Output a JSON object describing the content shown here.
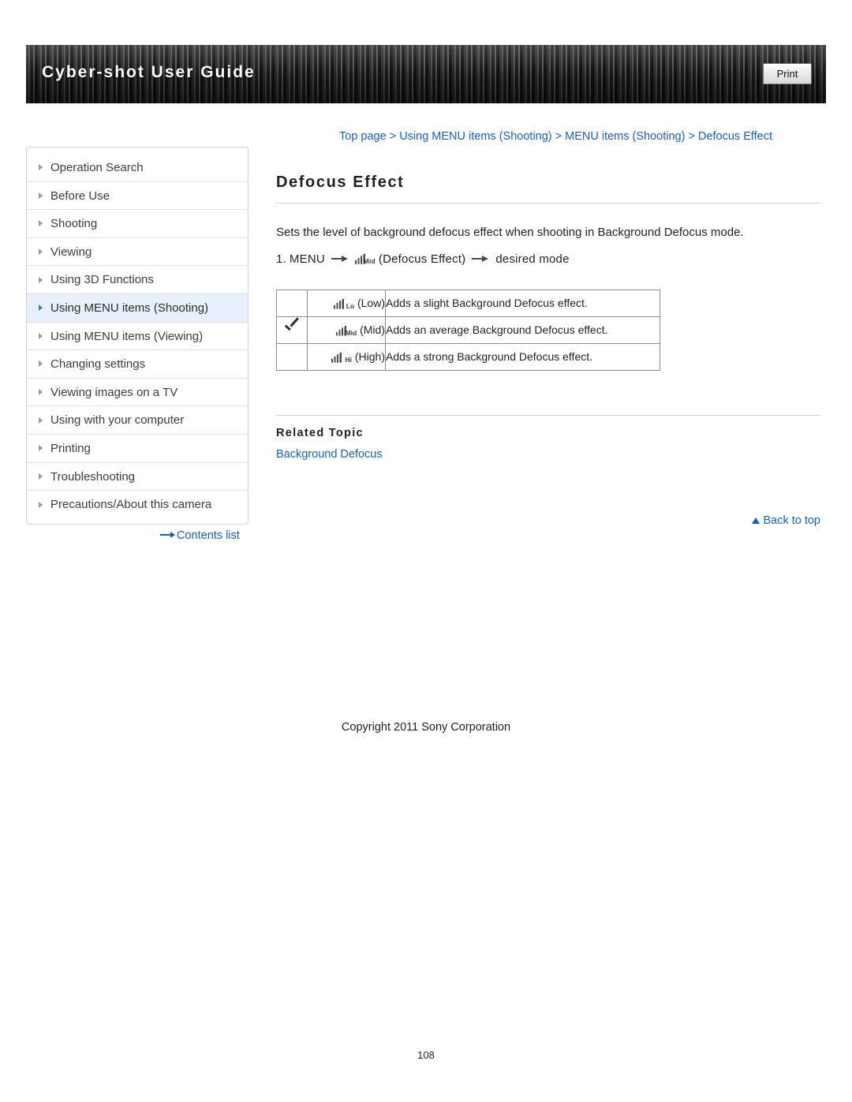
{
  "header": {
    "title": "Cyber-shot User Guide",
    "print_label": "Print"
  },
  "breadcrumb": {
    "items": [
      "Top page",
      "Using MENU items (Shooting)",
      "MENU items (Shooting)",
      "Defocus Effect"
    ],
    "separator": ">"
  },
  "sidebar": {
    "items": [
      {
        "label": "Operation Search",
        "active": false
      },
      {
        "label": "Before Use",
        "active": false
      },
      {
        "label": "Shooting",
        "active": false
      },
      {
        "label": "Viewing",
        "active": false
      },
      {
        "label": "Using 3D Functions",
        "active": false
      },
      {
        "label": "Using MENU items (Shooting)",
        "active": true
      },
      {
        "label": "Using MENU items (Viewing)",
        "active": false
      },
      {
        "label": "Changing settings",
        "active": false
      },
      {
        "label": "Viewing images on a TV",
        "active": false
      },
      {
        "label": "Using with your computer",
        "active": false
      },
      {
        "label": "Printing",
        "active": false
      },
      {
        "label": "Troubleshooting",
        "active": false
      },
      {
        "label": "Precautions/About this camera",
        "active": false
      }
    ],
    "contents_list_label": "Contents list"
  },
  "main": {
    "title": "Defocus Effect",
    "intro": "Sets the level of background defocus effect when shooting in Background Defocus mode.",
    "step": {
      "number": "1.",
      "menu_label": "MENU",
      "icon_label": "Mid",
      "icon_text": "(Defocus Effect)",
      "tail_text": "desired mode"
    },
    "options": [
      {
        "checked": false,
        "icon_label": "Lo",
        "name": "(Low)",
        "description": "Adds a slight Background Defocus effect."
      },
      {
        "checked": true,
        "icon_label": "Mid",
        "name": "(Mid)",
        "description": "Adds an average Background Defocus effect."
      },
      {
        "checked": false,
        "icon_label": "Hi",
        "name": "(High)",
        "description": "Adds a strong Background Defocus effect."
      }
    ],
    "related_topic_title": "Related Topic",
    "related_link": "Background Defocus",
    "back_to_top": "Back to top"
  },
  "footer": {
    "copyright": "Copyright 2011 Sony Corporation",
    "page_number": "108"
  },
  "colors": {
    "link": "#1b5fb0",
    "active_row": "#e8f1fb",
    "text": "#231f20"
  }
}
